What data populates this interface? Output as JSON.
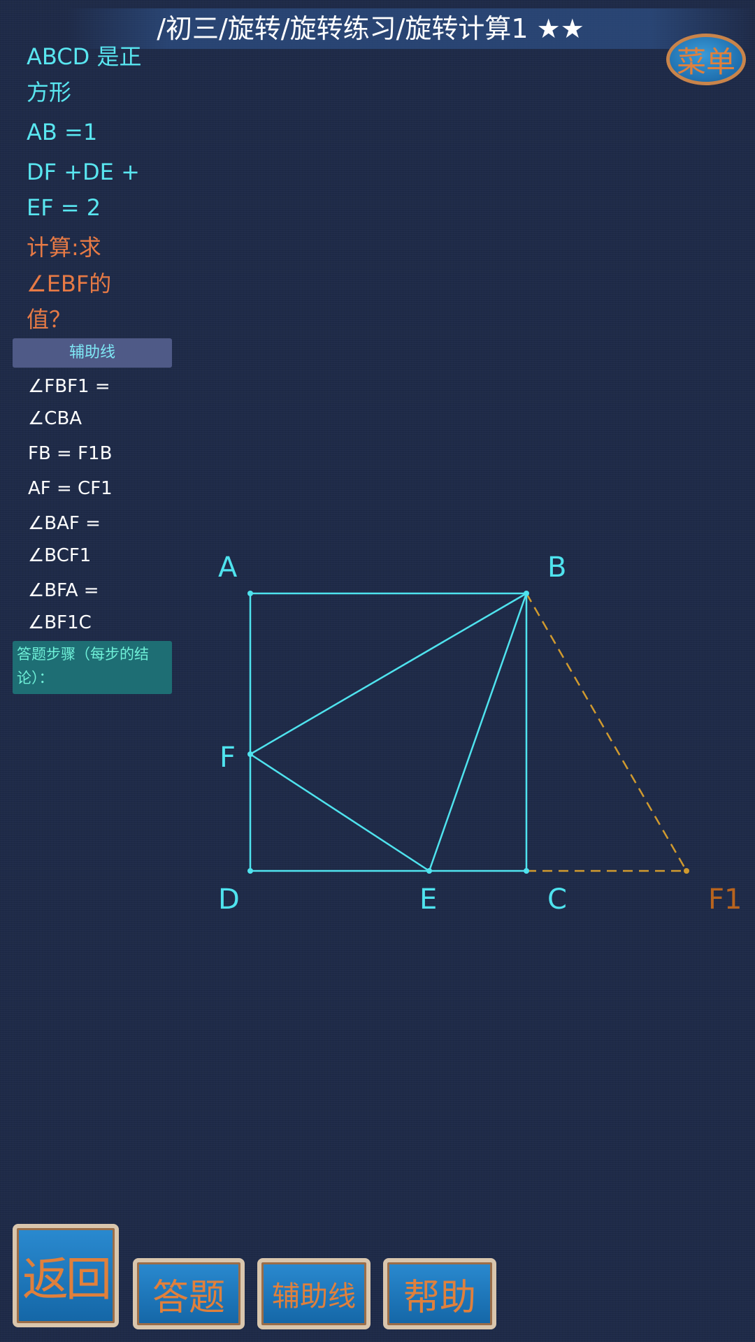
{
  "breadcrumb": "/初三/旋转/旋转练习/旋转计算1 ★★",
  "menu_label": "菜单",
  "problem": {
    "lines": [
      {
        "text": "ABCD 是正",
        "color": "cyan"
      },
      {
        "text": "方形",
        "color": "cyan"
      },
      {
        "text": "AB =1",
        "color": "cyan"
      },
      {
        "text": "DF +DE +",
        "color": "cyan"
      },
      {
        "text": "EF = 2",
        "color": "cyan"
      },
      {
        "text": "计算:求",
        "color": "orange"
      },
      {
        "text": "∠EBF的",
        "color": "orange"
      },
      {
        "text": "值？",
        "color": "orange"
      }
    ]
  },
  "aux": {
    "header": "辅助线",
    "items": [
      "∠FBF1 =",
      "∠CBA",
      "FB = F1B",
      "AF = CF1",
      "∠BAF =",
      "∠BCF1",
      "∠BFA =",
      "∠BF1C"
    ]
  },
  "steps_label": "答题步骤（每步的结论）：",
  "figure": {
    "points": {
      "A": "A",
      "B": "B",
      "C": "C",
      "D": "D",
      "E": "E",
      "F": "F",
      "F1": "F1"
    }
  },
  "buttons": {
    "back": "返回",
    "answer": "答题",
    "auxline": "辅助线",
    "help": "帮助"
  },
  "colors": {
    "accent": "#59e6f0",
    "highlight": "#e77a45",
    "aux_line": "#d09a2e",
    "background": "#1e2a48"
  }
}
